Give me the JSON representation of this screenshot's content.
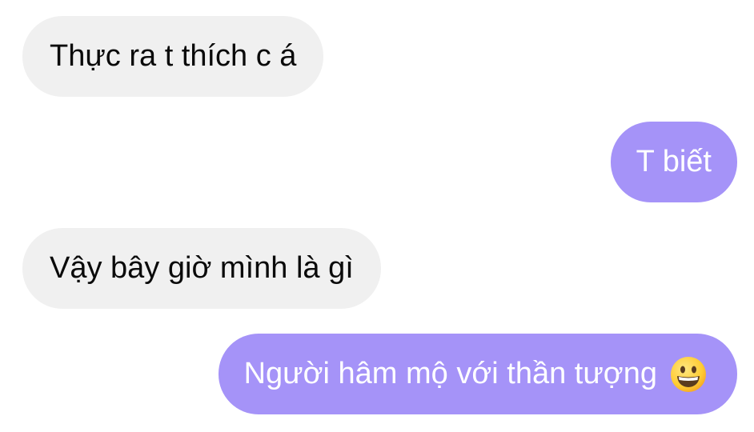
{
  "messages": [
    {
      "sender": "them",
      "text": "Thực ra t thích c á"
    },
    {
      "sender": "me",
      "text": "T biết"
    },
    {
      "sender": "them",
      "text": "Vậy bây giờ mình là gì"
    },
    {
      "sender": "me",
      "text": "Người hâm mộ với thần tượng",
      "emoji": "grinning-face-icon"
    }
  ],
  "colors": {
    "incoming_bubble": "#f0f0f0",
    "outgoing_bubble": "#a593f8",
    "incoming_text": "#0a0a0a",
    "outgoing_text": "#ffffff"
  }
}
